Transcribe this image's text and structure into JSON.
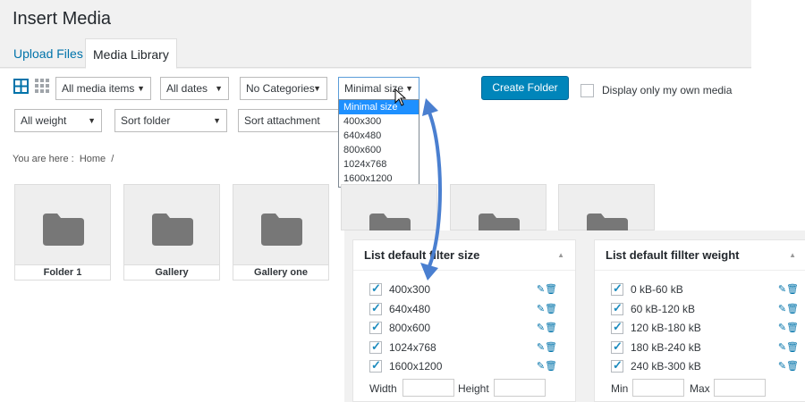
{
  "window": {
    "title": "Insert Media"
  },
  "tabs": [
    {
      "label": "Upload Files"
    },
    {
      "label": "Media Library"
    }
  ],
  "toolbar": {
    "media_filter": "All media items",
    "date_filter": "All dates",
    "category_filter": "No Categories",
    "size_filter": "Minimal size",
    "weight_filter": "All weight",
    "sort_folder": "Sort folder",
    "sort_attachment": "Sort attachment",
    "create_folder": "Create Folder",
    "own_media_label": "Display only my own media"
  },
  "size_dropdown": {
    "options": [
      "Minimal size",
      "400x300",
      "640x480",
      "800x600",
      "1024x768",
      "1600x1200"
    ],
    "selected": "Minimal size"
  },
  "breadcrumb": {
    "prefix": "You are here :",
    "home": "Home",
    "sep": "/"
  },
  "folders": [
    {
      "name": "Folder 1"
    },
    {
      "name": "Gallery"
    },
    {
      "name": "Gallery one"
    }
  ],
  "size_panel": {
    "title": "List default filter size",
    "items": [
      "400x300",
      "640x480",
      "800x600",
      "1024x768",
      "1600x1200"
    ],
    "field1_label": "Width",
    "field2_label": "Height"
  },
  "weight_panel": {
    "title": "List default fillter weight",
    "items": [
      "0 kB-60 kB",
      "60 kB-120 kB",
      "120 kB-180 kB",
      "180 kB-240 kB",
      "240 kB-300 kB"
    ],
    "field1_label": "Min",
    "field2_label": "Max"
  },
  "colors": {
    "primary": "#0085ba",
    "link": "#0073aa",
    "arrow": "#4a7fd0",
    "highlight": "#1e90ff"
  }
}
